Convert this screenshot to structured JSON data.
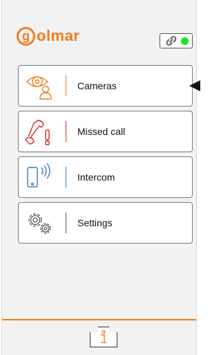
{
  "header": {
    "logo_letter": "g",
    "logo_text": "olmar",
    "brand_color": "#f07d1c",
    "link_status_color": "#19e619",
    "link_icon": "link-icon"
  },
  "menu": {
    "items": [
      {
        "label": "Cameras",
        "icon": "camera-eye-icon",
        "accent": "#f07d1c"
      },
      {
        "label": "Missed call",
        "icon": "missed-call-icon",
        "accent": "#e02020"
      },
      {
        "label": "Intercom",
        "icon": "intercom-phone-icon",
        "accent": "#3a73c8"
      },
      {
        "label": "Settings",
        "icon": "settings-gears-icon",
        "accent": "#555555"
      }
    ]
  },
  "footer": {
    "info_icon": "info-icon"
  }
}
